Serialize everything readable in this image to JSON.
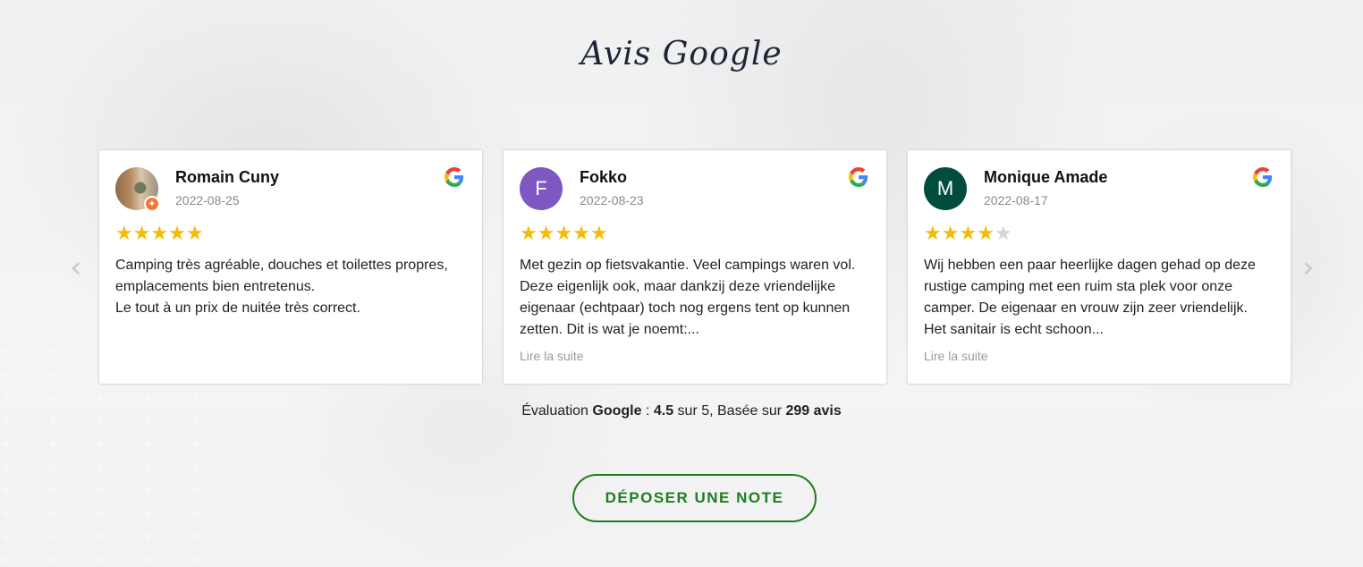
{
  "section": {
    "title": "Avis Google"
  },
  "reviews": [
    {
      "name": "Romain Cuny",
      "date": "2022-08-25",
      "avatar_type": "photo",
      "rating": 5,
      "text": "Camping très agréable, douches et toilettes propres, emplacements bien entretenus.\nLe tout à un prix de nuitée très correct.",
      "read_more": ""
    },
    {
      "name": "Fokko",
      "date": "2022-08-23",
      "avatar_type": "initial",
      "avatar_initial": "F",
      "avatar_color": "#7e57c2",
      "rating": 5,
      "text": "Met gezin op fietsvakantie. Veel campings waren vol. Deze eigenlijk ook, maar dankzij deze vriendelijke eigenaar (echtpaar) toch nog ergens tent op kunnen zetten. Dit is wat je noemt:...",
      "read_more": "Lire la suite"
    },
    {
      "name": "Monique Amade",
      "date": "2022-08-17",
      "avatar_type": "initial",
      "avatar_initial": "M",
      "avatar_color": "#004d40",
      "rating": 4,
      "text": "Wij hebben een paar heerlijke dagen gehad op deze rustige camping met een ruim sta plek voor onze camper. De eigenaar en vrouw zijn zeer vriendelijk. Het sanitair is echt schoon...",
      "read_more": "Lire la suite"
    }
  ],
  "rating_max": 5,
  "colors": {
    "star_on": "#f6bb06",
    "star_off": "#d5d5d5",
    "accent": "#1f7d1f"
  },
  "icons": {
    "source": "google-g-icon",
    "prev": "chevron-left-icon",
    "next": "chevron-right-icon"
  },
  "summary": {
    "prefix": "Évaluation",
    "brand": "Google",
    "sep": " : ",
    "score": "4.5",
    "mid": " sur 5, Basée sur ",
    "count": "299 avis"
  },
  "cta": {
    "label": "DÉPOSER UNE NOTE"
  }
}
